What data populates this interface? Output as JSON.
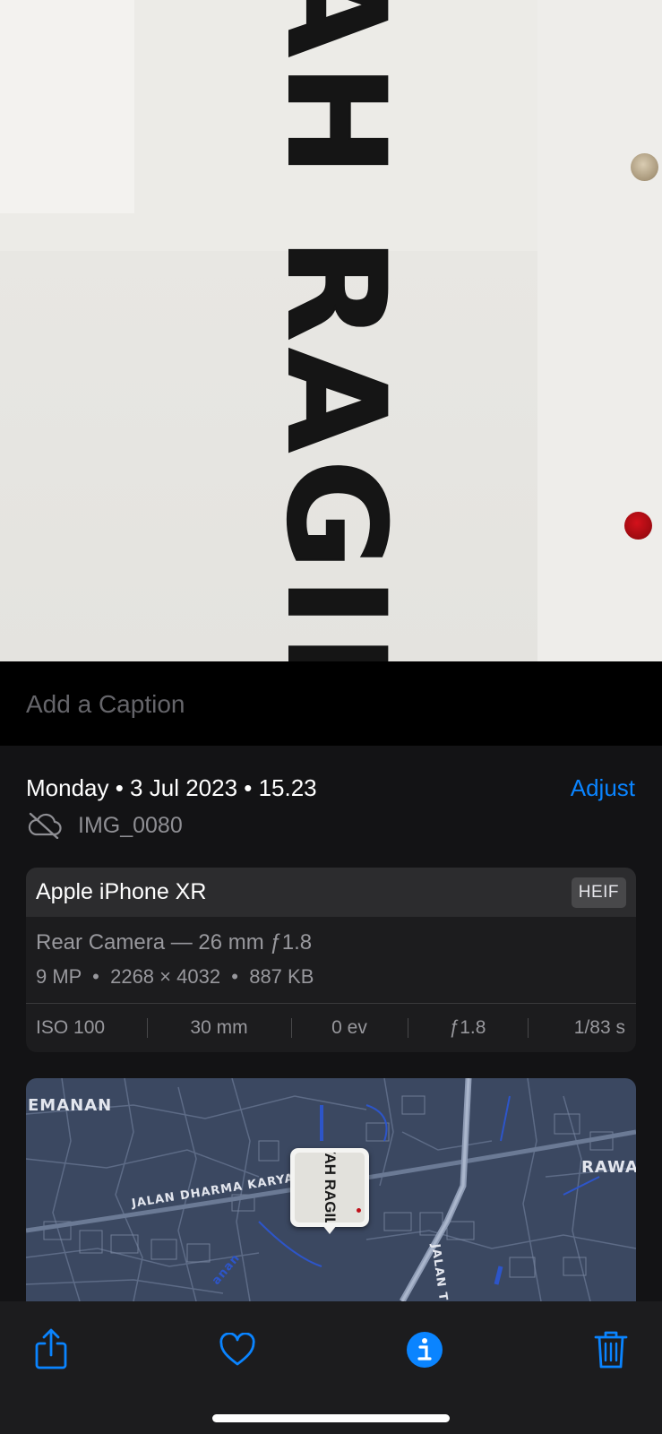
{
  "photo": {
    "handwritten_text": "YAH RAGILI"
  },
  "caption": {
    "placeholder": "Add a Caption"
  },
  "info": {
    "datetime": "Monday • 3 Jul 2023 • 15.23",
    "adjust_label": "Adjust",
    "filename": "IMG_0080",
    "cloud_status_icon": "cloud-slash-icon"
  },
  "camera_card": {
    "device": "Apple iPhone XR",
    "format_badge": "HEIF",
    "lens": "Rear Camera — 26 mm ƒ1.8",
    "specs": "9 MP  •  2268 × 4032  •  887 KB",
    "exif": {
      "iso": "ISO 100",
      "focal": "30 mm",
      "ev": "0 ev",
      "aperture": "ƒ1.8",
      "shutter": "1/83 s"
    }
  },
  "map": {
    "labels": {
      "area_left": "EMANAN",
      "area_right": "RAWA",
      "road_1": "JALAN DHARMA KARYA",
      "road_2": "JALAN TOL LINGK",
      "road_3": "anan"
    },
    "pin_thumbnail_text": "YAH RAGILI"
  },
  "toolbar": {
    "icons": [
      "share-icon",
      "heart-icon",
      "info-icon",
      "trash-icon"
    ],
    "accent": "#0a84ff"
  }
}
